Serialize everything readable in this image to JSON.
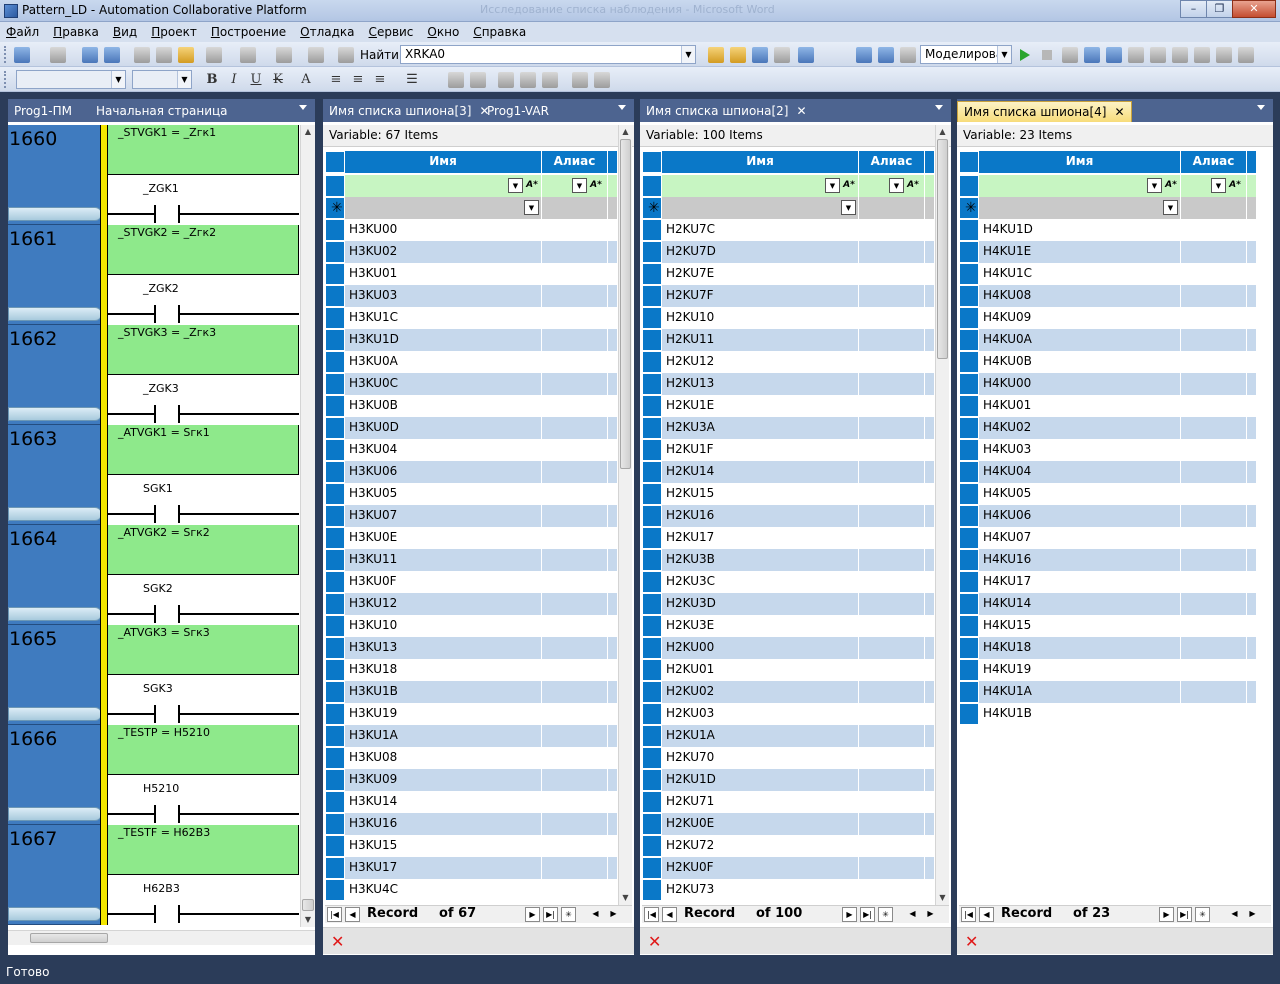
{
  "window": {
    "title": "Pattern_LD - Automation Collaborative Platform",
    "ghost_title": "Исследование списка наблюдения - Microsoft Word"
  },
  "menu": [
    "Файл",
    "Правка",
    "Вид",
    "Проект",
    "Построение",
    "Отладка",
    "Сервис",
    "Окно",
    "Справка"
  ],
  "toolbar": {
    "find_label": "Найти",
    "find_value": "XRKA0",
    "mode_value": "Моделирова"
  },
  "ladder_panel": {
    "tabs": [
      {
        "label": "Prog1-ПМ"
      },
      {
        "label": "Начальная страница"
      }
    ],
    "rungs": [
      {
        "num": "1660",
        "formula": "_STVGK1  =  _Zгк1",
        "contact": "_ZGK1"
      },
      {
        "num": "1661",
        "formula": "_STVGK2  =  _Zгк2",
        "contact": "_ZGK2"
      },
      {
        "num": "1662",
        "formula": "_STVGK3  =  _Zгк3",
        "contact": "_ZGK3"
      },
      {
        "num": "1663",
        "formula": "_ATVGK1  =  Sгк1",
        "contact": "SGK1"
      },
      {
        "num": "1664",
        "formula": "_ATVGK2  =  Sгк2",
        "contact": "SGK2"
      },
      {
        "num": "1665",
        "formula": "_ATVGK3  =  Sгк3",
        "contact": "SGK3"
      },
      {
        "num": "1666",
        "formula": "_TESTP  =  H5210",
        "contact": "H5210"
      },
      {
        "num": "1667",
        "formula": "_TESTF  =  H62B3",
        "contact": "H62B3"
      }
    ]
  },
  "spy_panels": [
    {
      "tabs": [
        {
          "label": "Имя списка шпиона[3]",
          "active": false,
          "closable": true
        },
        {
          "label": "Prog1-VAR",
          "active": false,
          "closable": false
        }
      ],
      "header": "Variable: 67 Items",
      "col_name": "Имя",
      "col_alias": "Алиас",
      "record_label": "Record",
      "record_of": "of 67",
      "rows": [
        "H3KU00",
        "H3KU02",
        "H3KU01",
        "H3KU03",
        "H3KU1C",
        "H3KU1D",
        "H3KU0A",
        "H3KU0C",
        "H3KU0B",
        "H3KU0D",
        "H3KU04",
        "H3KU06",
        "H3KU05",
        "H3KU07",
        "H3KU0E",
        "H3KU11",
        "H3KU0F",
        "H3KU12",
        "H3KU10",
        "H3KU13",
        "H3KU18",
        "H3KU1B",
        "H3KU19",
        "H3KU1A",
        "H3KU08",
        "H3KU09",
        "H3KU14",
        "H3KU16",
        "H3KU15",
        "H3KU17",
        "H3KU4C"
      ]
    },
    {
      "tabs": [
        {
          "label": "Имя списка шпиона[2]",
          "active": false,
          "closable": true
        }
      ],
      "header": "Variable: 100 Items",
      "col_name": "Имя",
      "col_alias": "Алиас",
      "record_label": "Record",
      "record_of": "of 100",
      "rows": [
        "H2KU7C",
        "H2KU7D",
        "H2KU7E",
        "H2KU7F",
        "H2KU10",
        "H2KU11",
        "H2KU12",
        "H2KU13",
        "H2KU1E",
        "H2KU3A",
        "H2KU1F",
        "H2KU14",
        "H2KU15",
        "H2KU16",
        "H2KU17",
        "H2KU3B",
        "H2KU3C",
        "H2KU3D",
        "H2KU3E",
        "H2KU00",
        "H2KU01",
        "H2KU02",
        "H2KU03",
        "H2KU1A",
        "H2KU70",
        "H2KU1D",
        "H2KU71",
        "H2KU0E",
        "H2KU72",
        "H2KU0F",
        "H2KU73"
      ]
    },
    {
      "tabs": [
        {
          "label": "Имя списка шпиона[4]",
          "active": true,
          "closable": true
        }
      ],
      "header": "Variable: 23 Items",
      "col_name": "Имя",
      "col_alias": "Алиас",
      "record_label": "Record",
      "record_of": "of 23",
      "rows": [
        "H4KU1D",
        "H4KU1E",
        "H4KU1C",
        "H4KU08",
        "H4KU09",
        "H4KU0A",
        "H4KU0B",
        "H4KU00",
        "H4KU01",
        "H4KU02",
        "H4KU03",
        "H4KU04",
        "H4KU05",
        "H4KU06",
        "H4KU07",
        "H4KU16",
        "H4KU17",
        "H4KU14",
        "H4KU15",
        "H4KU18",
        "H4KU19",
        "H4KU1A",
        "H4KU1B"
      ]
    }
  ],
  "status": "Готово"
}
